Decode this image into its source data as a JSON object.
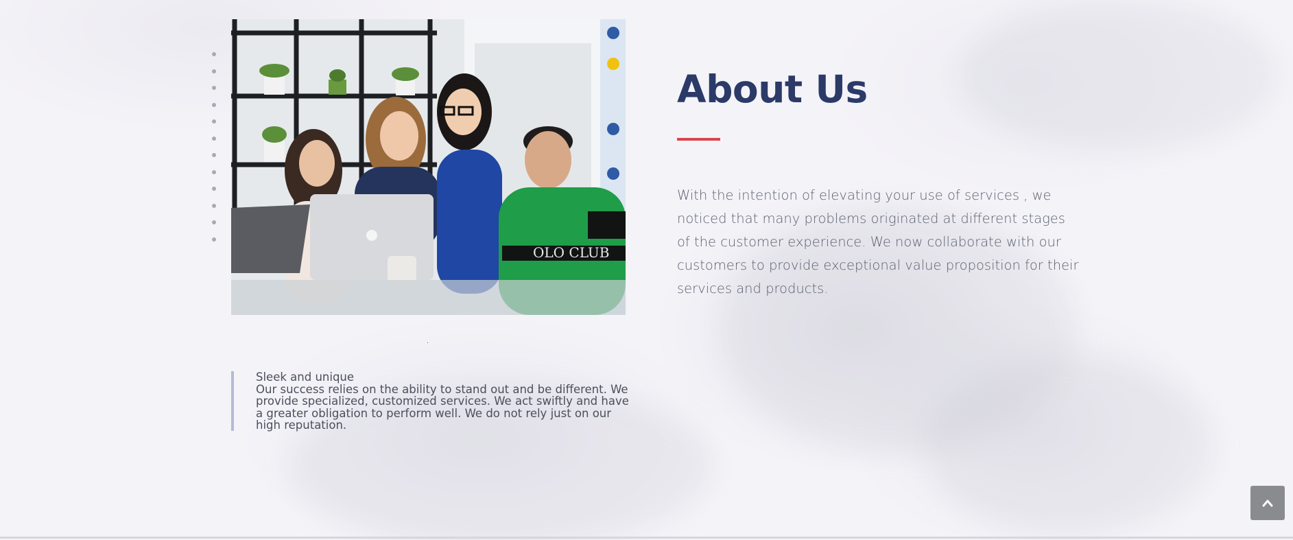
{
  "about": {
    "title": "About Us",
    "accent_color": "#d9444d",
    "title_color": "#2b3a67",
    "text": " With the intention of elevating your use of services , we noticed that many problems originated at different stages of the customer experience. We now collaborate with our customers to provide exceptional value proposition for their services and products."
  },
  "quote": {
    "title": "Sleek and unique",
    "body": "Our success relies on the ability to stand out and be different. We provide specialized, customized services. We act swiftly and have a greater obligation to perform well. We do not rely just on our high reputation."
  },
  "scroll_top": {
    "icon": "chevron-up-icon"
  }
}
